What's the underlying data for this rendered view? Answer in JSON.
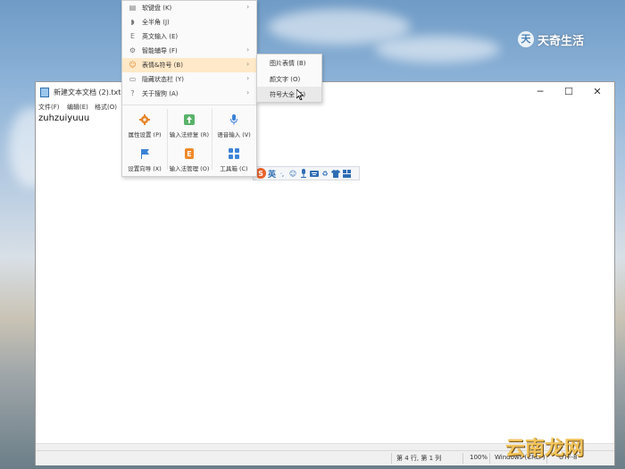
{
  "notepad": {
    "title": "新建文本文档 (2).txt - 记",
    "menus": [
      "文件(F)",
      "编辑(E)",
      "格式(O)"
    ],
    "content": "zuhzuiyuuu",
    "window_controls": {
      "minimize": "─",
      "maximize": "☐",
      "close": "✕"
    },
    "status": {
      "position": "第 4 行, 第 1 列",
      "zoom": "100%",
      "line_ending": "Windows (CRLF)",
      "encoding": "UTF-8"
    }
  },
  "ime_toolbar": {
    "logo": "S",
    "mode": "英",
    "icons": [
      "moon-punct-icon",
      "emoji-icon",
      "mic-icon",
      "keyboard-icon",
      "skin-icon",
      "clothes-icon",
      "toolbox-icon"
    ]
  },
  "context_menu": {
    "items": [
      {
        "icon": "▤",
        "label": "软键盘 (K)",
        "arrow": "›"
      },
      {
        "icon": "◗",
        "label": "全半角 (J)",
        "arrow": ""
      },
      {
        "icon": "E",
        "label": "英文输入 (E)",
        "arrow": ""
      },
      {
        "icon": "⚙",
        "label": "智能辅导 (F)",
        "arrow": "›"
      },
      {
        "icon": "☺",
        "label": "表情&符号 (B)",
        "arrow": "›"
      },
      {
        "icon": "▭",
        "label": "隐藏状态栏 (Y)",
        "arrow": "›"
      },
      {
        "icon": "?",
        "label": "关于搜狗 (A)",
        "arrow": "›"
      }
    ],
    "tools": [
      {
        "label": "属性设置 (P)",
        "color": "#e8862a"
      },
      {
        "label": "输入法修复 (R)",
        "color": "#59b36a"
      },
      {
        "label": "语音输入 (V)",
        "color": "#3c83d6"
      },
      {
        "label": "设置向导 (X)",
        "color": "#3c83d6"
      },
      {
        "label": "输入法管理 (O)",
        "color": "#f08a2a"
      },
      {
        "label": "工具箱 (C)",
        "color": "#3c83d6"
      }
    ]
  },
  "submenu": {
    "items": [
      "图片表情 (B)",
      "颜文字 (O)",
      "符号大全 (S)"
    ]
  },
  "watermarks": {
    "top": "天奇生活",
    "top_logo": "天",
    "bottom": "云南龙网"
  }
}
